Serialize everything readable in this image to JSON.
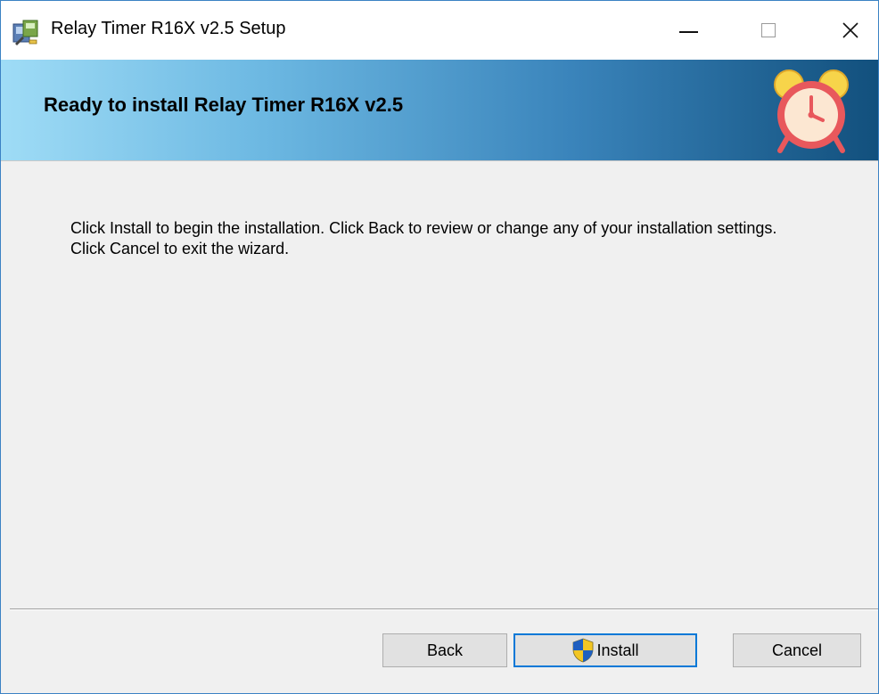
{
  "window": {
    "title": "Relay Timer R16X v2.5 Setup",
    "icon": "installer-app-icon",
    "controls": {
      "minimize": "minimize-icon",
      "maximize": "maximize-icon",
      "close": "close-icon"
    }
  },
  "banner": {
    "title": "Ready to install Relay Timer R16X v2.5",
    "icon": "alarm-clock-icon"
  },
  "body": {
    "message": "Click Install to begin the installation. Click Back to review or change any of your installation settings. Click Cancel to exit the wizard."
  },
  "buttons": {
    "back": "Back",
    "install": "Install",
    "install_icon": "uac-shield-icon",
    "cancel": "Cancel"
  },
  "colors": {
    "banner_gradient_start": "#9fdcf6",
    "banner_gradient_end": "#12507d",
    "focus_border": "#0078d7",
    "clock_frame": "#e8585c",
    "clock_bells": "#f7d44a",
    "clock_face": "#fce7d2"
  }
}
